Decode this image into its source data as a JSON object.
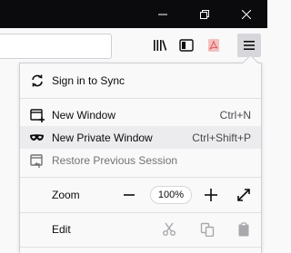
{
  "window": {
    "minimize_icon": "minimize-icon",
    "restore_icon": "restore-icon",
    "close_icon": "close-icon"
  },
  "toolbar": {
    "url_value": "",
    "icons": [
      "library-icon",
      "sidebar-icon",
      "pdf-icon",
      "hamburger-menu-icon"
    ]
  },
  "menu": {
    "sign_in": {
      "label": "Sign in to Sync",
      "icon": "sync-icon"
    },
    "new_window": {
      "label": "New Window",
      "shortcut": "Ctrl+N",
      "icon": "new-window-icon"
    },
    "new_private_window": {
      "label": "New Private Window",
      "shortcut": "Ctrl+Shift+P",
      "icon": "private-mask-icon"
    },
    "restore_session": {
      "label": "Restore Previous Session",
      "icon": "restore-session-icon"
    },
    "zoom": {
      "label": "Zoom",
      "value": "100%",
      "minus": "−",
      "plus": "+"
    },
    "edit": {
      "label": "Edit",
      "cut_icon": "cut-icon",
      "copy_icon": "copy-icon",
      "paste_icon": "paste-icon"
    }
  },
  "colors": {
    "titlebar": "#0b0b0d",
    "panel_bg": "#f9f9fa",
    "hover": "#ececee",
    "text": "#0c0c0d",
    "disabled": "#737373"
  }
}
